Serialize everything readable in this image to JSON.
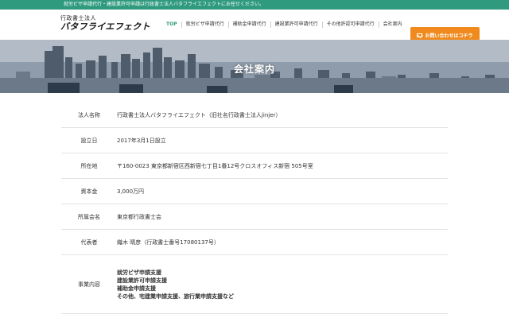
{
  "topbar": {
    "text": "就労ビザ申請代行・建設業許可申請は行政書士法人バタフライエフェクトにお任せください。"
  },
  "logo": {
    "sub": "行政書士法人",
    "main": "バタフライエフェクト"
  },
  "nav": {
    "items": [
      {
        "label": "TOP"
      },
      {
        "label": "就労ビザ申請代行"
      },
      {
        "label": "補助金申請代行"
      },
      {
        "label": "建設業許可申請代行"
      },
      {
        "label": "その他許認可申請代行"
      },
      {
        "label": "会社案内"
      }
    ]
  },
  "cta": {
    "label": "お問い合わせはコチラ",
    "icon": "mail-icon"
  },
  "hero": {
    "title": "会社案内"
  },
  "company": {
    "rows": [
      {
        "label": "法人名称",
        "value": "行政書士法人バタフライエフェクト（旧社名行政書士法人jinjer）"
      },
      {
        "label": "設立日",
        "value": "2017年3月1日設立"
      },
      {
        "label": "所在地",
        "value": "〒160-0023 東京都新宿区西新宿七丁目1番12号クロスオフィス新宿 505号室"
      },
      {
        "label": "資本金",
        "value": "3,000万円"
      },
      {
        "label": "所属会名",
        "value": "東京都行政書士会"
      },
      {
        "label": "代表者",
        "value": "織木 晴彦（行政書士番号17080137号）"
      }
    ],
    "business": {
      "label": "事業内容",
      "lines": [
        "就労ビザ申請支援",
        "建設業許可申請支援",
        "補助金申請支援",
        "その他、宅建業申請支援、旅行業申請支援など"
      ]
    }
  },
  "colors": {
    "accent": "#2f9a7d",
    "cta": "#f08a1c"
  }
}
